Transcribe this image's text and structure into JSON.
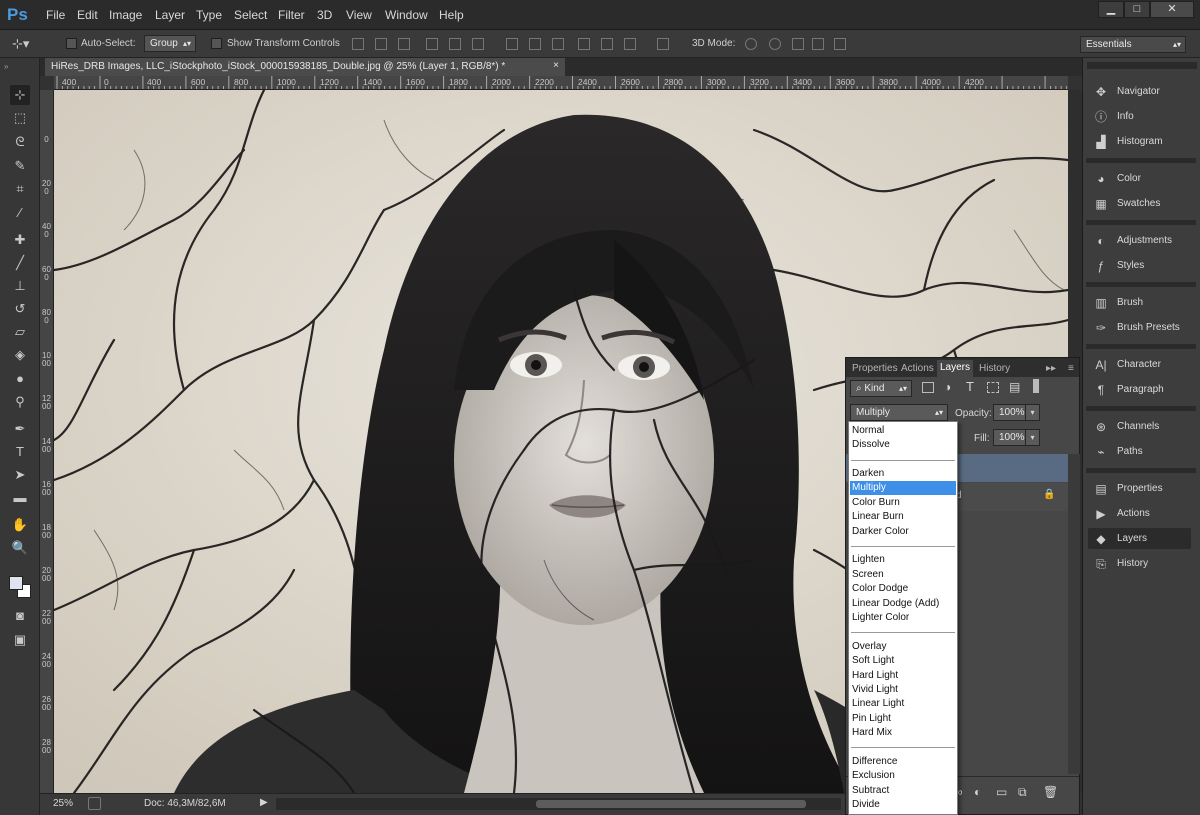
{
  "app": {
    "logo": "Ps"
  },
  "menu": [
    "File",
    "Edit",
    "Image",
    "Layer",
    "Type",
    "Select",
    "Filter",
    "3D",
    "View",
    "Window",
    "Help"
  ],
  "window_controls": [
    "minimize",
    "maximize",
    "close"
  ],
  "options": {
    "auto_select_label": "Auto-Select:",
    "auto_select_value": "Group",
    "show_transform_label": "Show Transform Controls",
    "mode_3d_label": "3D Mode:",
    "workspace": "Essentials"
  },
  "document": {
    "tab_title": "HiRes_DRB Images, LLC_iStockphoto_iStock_000015938185_Double.jpg @ 25% (Layer 1, RGB/8*) *",
    "close": "×"
  },
  "ruler_h": [
    "400",
    "0",
    "400",
    "600",
    "800",
    "1000",
    "1200",
    "1400",
    "1600",
    "1800",
    "2000",
    "2200",
    "2400",
    "2600",
    "2800",
    "3000",
    "3200",
    "3400",
    "3600",
    "3800",
    "4000",
    "4200"
  ],
  "ruler_v": [
    "0",
    "200",
    "400",
    "600",
    "800",
    "1000",
    "1200",
    "1400",
    "1600",
    "1800",
    "2000",
    "2200",
    "2400",
    "2600",
    "2800"
  ],
  "status": {
    "zoom": "25%",
    "doc": "Doc: 46,3M/82,6M"
  },
  "layers_panel": {
    "tabs": [
      "Properties",
      "Actions",
      "Layers",
      "History"
    ],
    "active_tab": "Layers",
    "filter_kind": "Kind",
    "blend_mode": "Multiply",
    "opacity_label": "Opacity:",
    "opacity_value": "100%",
    "fill_label": "Fill:",
    "fill_value": "100%"
  },
  "blend_modes": [
    [
      "Normal",
      "Dissolve"
    ],
    [
      "Darken",
      "Multiply",
      "Color Burn",
      "Linear Burn",
      "Darker Color"
    ],
    [
      "Lighten",
      "Screen",
      "Color Dodge",
      "Linear Dodge (Add)",
      "Lighter Color"
    ],
    [
      "Overlay",
      "Soft Light",
      "Hard Light",
      "Vivid Light",
      "Linear Light",
      "Pin Light",
      "Hard Mix"
    ],
    [
      "Difference",
      "Exclusion",
      "Subtract",
      "Divide"
    ]
  ],
  "selected_blend_mode": "Multiply",
  "dock": [
    {
      "group": 1,
      "items": [
        {
          "label": "Navigator",
          "icon": "navigator-icon"
        },
        {
          "label": "Info",
          "icon": "info-icon"
        },
        {
          "label": "Histogram",
          "icon": "histogram-icon"
        }
      ]
    },
    {
      "group": 2,
      "items": [
        {
          "label": "Color",
          "icon": "color-icon"
        },
        {
          "label": "Swatches",
          "icon": "swatches-icon"
        }
      ]
    },
    {
      "group": 3,
      "items": [
        {
          "label": "Adjustments",
          "icon": "adjustments-icon"
        },
        {
          "label": "Styles",
          "icon": "styles-icon"
        }
      ]
    },
    {
      "group": 4,
      "items": [
        {
          "label": "Brush",
          "icon": "brush-icon"
        },
        {
          "label": "Brush Presets",
          "icon": "brush-presets-icon"
        }
      ]
    },
    {
      "group": 5,
      "items": [
        {
          "label": "Character",
          "icon": "character-icon"
        },
        {
          "label": "Paragraph",
          "icon": "paragraph-icon"
        }
      ]
    },
    {
      "group": 6,
      "items": [
        {
          "label": "Channels",
          "icon": "channels-icon"
        },
        {
          "label": "Paths",
          "icon": "paths-icon"
        }
      ]
    },
    {
      "group": 7,
      "items": [
        {
          "label": "Properties",
          "icon": "properties-icon"
        },
        {
          "label": "Actions",
          "icon": "actions-icon"
        },
        {
          "label": "Layers",
          "icon": "layers-icon"
        },
        {
          "label": "History",
          "icon": "history-icon"
        }
      ]
    }
  ],
  "active_dock_item": "Layers",
  "colors": {
    "accent": "#3d8fe8",
    "ps_blue": "#4a9be0"
  }
}
